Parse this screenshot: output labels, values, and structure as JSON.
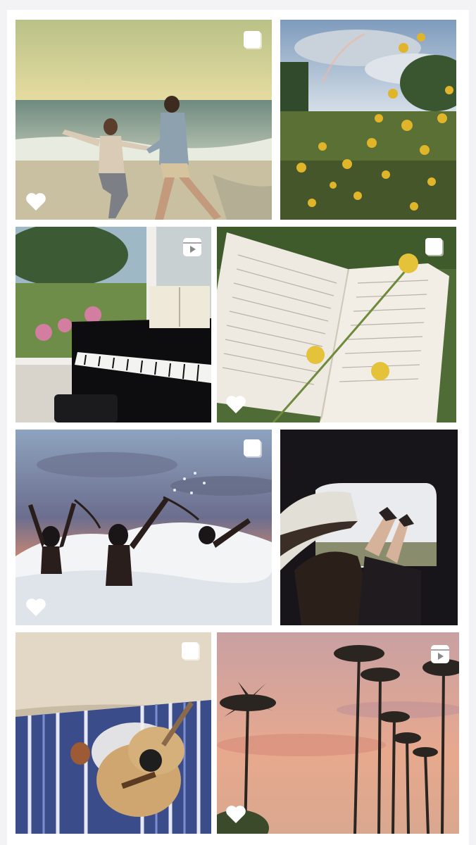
{
  "gallery": {
    "tiles": [
      {
        "id": "couple-running-beach",
        "type": "image",
        "liked": true
      },
      {
        "id": "yellow-wildflowers-rainbow",
        "type": "image",
        "liked": false
      },
      {
        "id": "piano-window",
        "type": "video",
        "liked": false
      },
      {
        "id": "open-book-flowers",
        "type": "image",
        "liked": true
      },
      {
        "id": "friends-ocean-wave",
        "type": "image",
        "liked": true
      },
      {
        "id": "car-window-feet",
        "type": "image",
        "liked": false
      },
      {
        "id": "guitar-on-blanket",
        "type": "image",
        "liked": false
      },
      {
        "id": "palm-trees-sunset",
        "type": "video",
        "liked": true
      }
    ]
  },
  "icons": {
    "multi_photo": "square-badge-icon",
    "reel": "play-badge-icon",
    "like": "heart-icon"
  },
  "colors": {
    "background": "#f3f3f5",
    "icon": "#ffffff"
  }
}
